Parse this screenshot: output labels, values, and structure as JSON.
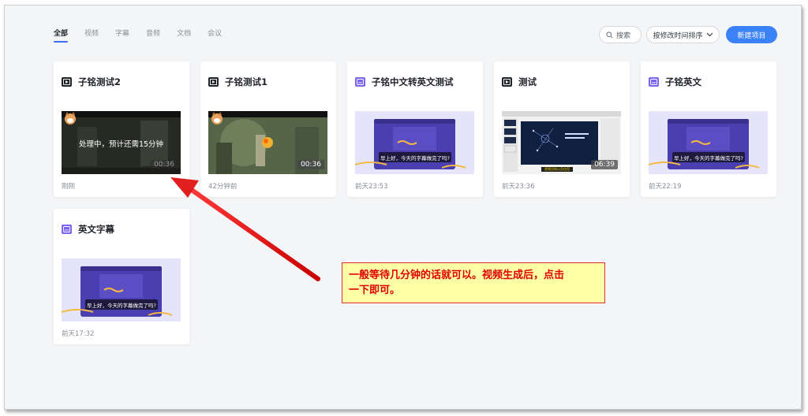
{
  "tabs": [
    "全部",
    "视频",
    "字幕",
    "音频",
    "文档",
    "会议"
  ],
  "toolbar": {
    "search_label": "搜索",
    "sort_label": "按修改时间排序",
    "new_label": "新建项目"
  },
  "cards": [
    {
      "title": "子铭测试2",
      "type": "video",
      "time": "刚刚",
      "processing": "处理中，预计还需15分钟",
      "duration": "00:36"
    },
    {
      "title": "子铭测试1",
      "type": "video",
      "time": "42分钟前",
      "duration": "00:36"
    },
    {
      "title": "子铭中文转英文测试",
      "type": "subtitle",
      "time": "前天23:53",
      "caption": "早上好，今天的字幕做完了吗?"
    },
    {
      "title": "测试",
      "type": "video",
      "time": "前天23:36",
      "duration": "06:39",
      "slide_caption": "视频总结以及应用"
    },
    {
      "title": "子铭英文",
      "type": "subtitle",
      "time": "前天22:19",
      "caption": "早上好，今天的字幕做完了吗?"
    },
    {
      "title": "英文字幕",
      "type": "subtitle",
      "time": "前天17:32",
      "caption": "早上好，今天的字幕做完了吗?"
    }
  ],
  "annotation": {
    "line1": "一般等待几分钟的话就可以。视频生成后，点击",
    "line2": "一下即可。"
  },
  "colors": {
    "accent": "#3b82f6",
    "annotation_text": "#e00000",
    "annotation_bg": "#ffffa6",
    "arrow": "#e02020"
  }
}
